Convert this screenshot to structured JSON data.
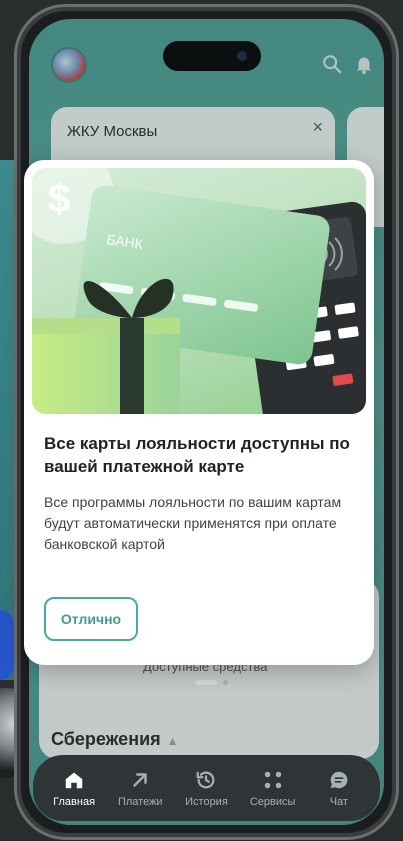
{
  "header": {
    "avatar": "avatar",
    "search_icon": "search-icon",
    "bell_icon": "bell-icon"
  },
  "background": {
    "card_title": "ЖКУ Москвы",
    "card_close": "×",
    "available_funds": "Доступные средства",
    "savings_title": "Сбережения"
  },
  "modal": {
    "illustration": {
      "card_label": "БАНК",
      "badge_symbol": "$"
    },
    "title": "Все карты лояльности доступны по вашей платежной карте",
    "body": "Все программы лояльности по вашим картам будут автоматически применятся при оплате банковской картой",
    "ok_button": "Отлично"
  },
  "pager": {
    "total": 2,
    "active": 1
  },
  "tabbar": {
    "items": [
      {
        "label": "Главная",
        "icon": "home-icon",
        "active": true
      },
      {
        "label": "Платежи",
        "icon": "arrow-up-right-icon",
        "active": false
      },
      {
        "label": "История",
        "icon": "history-icon",
        "active": false
      },
      {
        "label": "Сервисы",
        "icon": "grid-dots-icon",
        "active": false
      },
      {
        "label": "Чат",
        "icon": "chat-icon",
        "active": false
      }
    ]
  },
  "colors": {
    "accent": "#4aa8a3",
    "app_bg": "#56a39a",
    "tabbar": "#2f3536"
  }
}
